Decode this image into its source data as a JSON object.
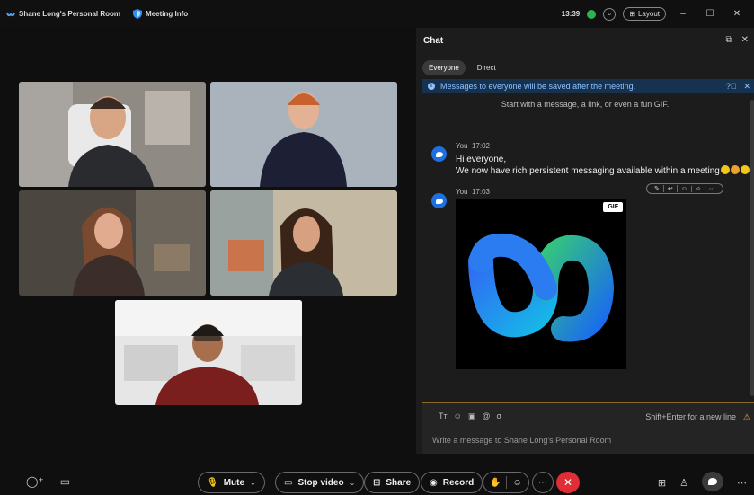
{
  "titlebar": {
    "room_name": "Shane Long's Personal Room",
    "meeting_info": "Meeting Info",
    "time": "13:39",
    "layout_label": "Layout"
  },
  "participants": [
    {
      "id": "p1",
      "shirt": "#2a2b2e",
      "bg": "#8f8a84"
    },
    {
      "id": "p2",
      "shirt": "#1d2035",
      "bg": "#9fa8b2"
    },
    {
      "id": "p3",
      "shirt": "#3b2d2a",
      "bg": "#5c564e"
    },
    {
      "id": "p4",
      "shirt": "#2b2f33",
      "bg": "#b4a992"
    },
    {
      "id": "p5",
      "shirt": "#7a1f1e",
      "bg": "#dcdcdc"
    }
  ],
  "chat": {
    "title": "Chat",
    "tabs": [
      "Everyone",
      "Direct"
    ],
    "active_tab": "Everyone",
    "banner": "Messages to everyone will be saved after the meeting.",
    "hint": "Start with a message, a link, or even a fun GIF.",
    "messages": [
      {
        "sender": "You",
        "time": "17:02",
        "lines": [
          "Hi everyone,",
          "We now have rich persistent messaging available within a meeting"
        ]
      },
      {
        "sender": "You",
        "time": "17:03",
        "gif_badge": "GIF"
      }
    ],
    "composer": {
      "format_label": "Tт",
      "hint": "Shift+Enter for a new line",
      "placeholder": "Write a message to Shane Long's Personal Room"
    }
  },
  "toolbar": {
    "mute": "Mute",
    "stop_video": "Stop video",
    "share": "Share",
    "record": "Record"
  },
  "colors": {
    "accent_blue": "#1e6fe0",
    "end_red": "#e02d36",
    "banner_bg": "#16324f",
    "status_green": "#2fb34f"
  }
}
